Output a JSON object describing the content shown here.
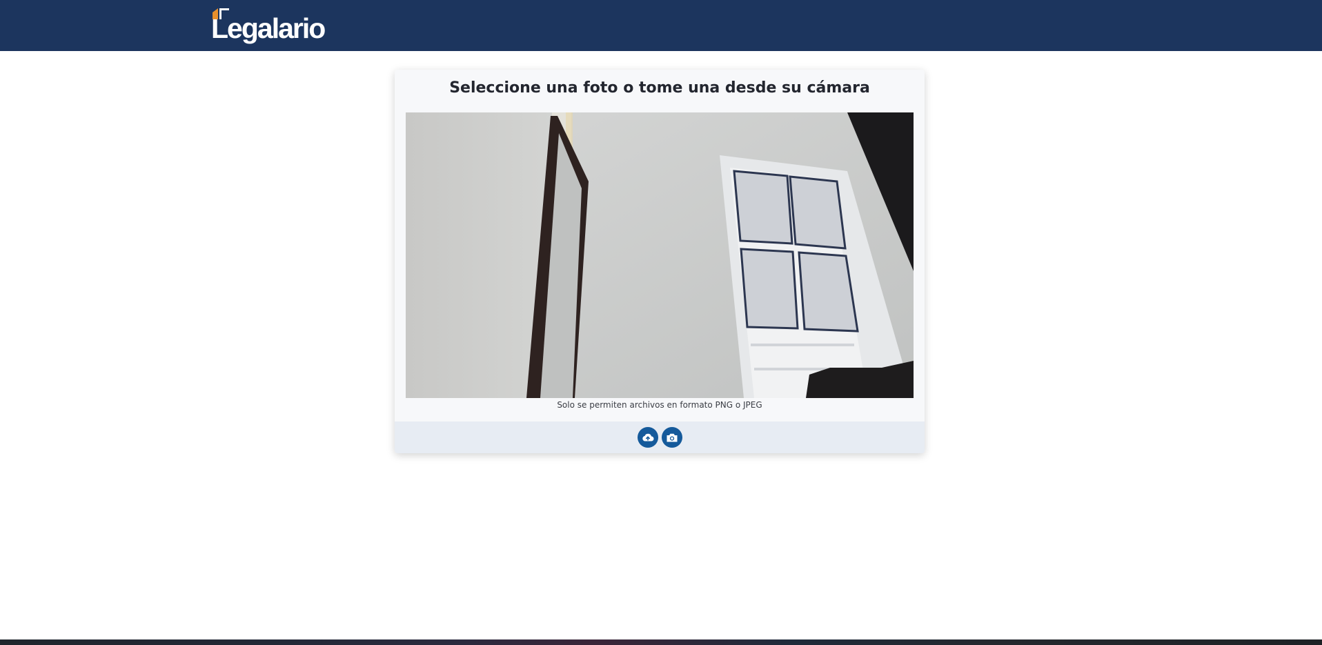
{
  "header": {
    "logo_text": "Legalario",
    "logo_accent_color": "#e8902c",
    "background_color": "#1c355e"
  },
  "card": {
    "title": "Seleccione una foto o tome una desde su cámara",
    "image_alt": "camera-preview",
    "hint": "Solo se permiten archivos en formato PNG o JPEG",
    "actions": [
      {
        "name": "upload-button",
        "icon": "cloud-upload-icon"
      },
      {
        "name": "camera-button",
        "icon": "camera-icon"
      }
    ],
    "accent_color": "#155a9b"
  }
}
